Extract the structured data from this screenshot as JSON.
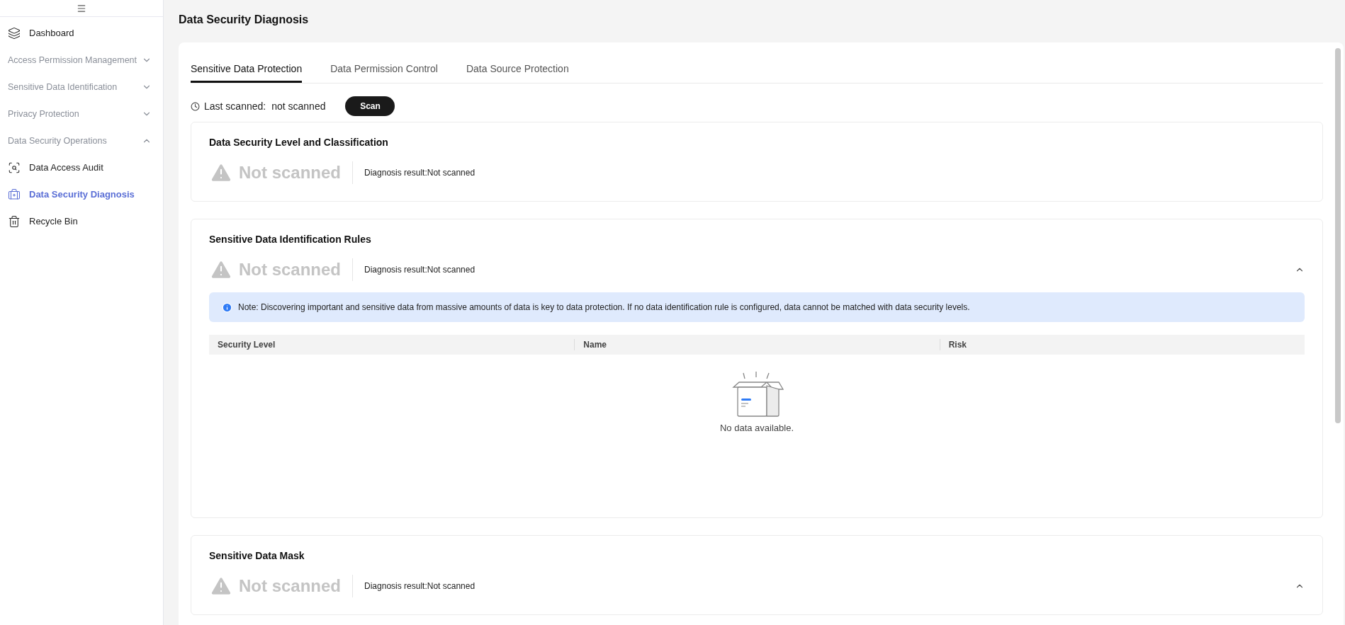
{
  "sidebar": {
    "items": [
      {
        "kind": "link",
        "label": "Dashboard",
        "selected": false
      },
      {
        "kind": "group",
        "label": "Access Permission Management",
        "expanded": false
      },
      {
        "kind": "group",
        "label": "Sensitive Data Identification",
        "expanded": false
      },
      {
        "kind": "group",
        "label": "Privacy Protection",
        "expanded": false
      },
      {
        "kind": "group",
        "label": "Data Security Operations",
        "expanded": true
      },
      {
        "kind": "link",
        "label": "Data Access Audit",
        "selected": false
      },
      {
        "kind": "link",
        "label": "Data Security Diagnosis",
        "selected": true
      },
      {
        "kind": "link",
        "label": "Recycle Bin",
        "selected": false
      }
    ]
  },
  "page_title": "Data Security Diagnosis",
  "tabs": [
    {
      "label": "Sensitive Data Protection",
      "selected": true
    },
    {
      "label": "Data Permission Control",
      "selected": false
    },
    {
      "label": "Data Source Protection",
      "selected": false
    }
  ],
  "scan": {
    "label": "Last scanned:",
    "value": "not scanned",
    "button": "Scan"
  },
  "sections": [
    {
      "kind": "plain",
      "title": "Data Security Level and Classification",
      "status": "Not scanned",
      "result": "Diagnosis result:Not scanned"
    },
    {
      "kind": "expandable",
      "expanded": true,
      "title": "Sensitive Data Identification Rules",
      "status": "Not scanned",
      "result": "Diagnosis result:Not scanned",
      "note": "Note: Discovering important and sensitive data from massive amounts of data is key to data protection. If no data identification rule is configured, data cannot be matched with data security levels.",
      "table": {
        "columns": [
          "Security Level",
          "Name",
          "Risk"
        ],
        "empty": "No data available."
      }
    },
    {
      "kind": "expandable",
      "expanded": true,
      "title": "Sensitive Data Mask",
      "status": "Not scanned",
      "result": "Diagnosis result:Not scanned"
    }
  ]
}
